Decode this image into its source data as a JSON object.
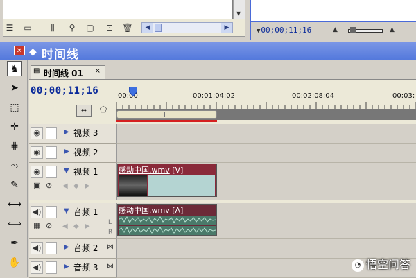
{
  "monitor": {
    "timecode": "00;00;11;16"
  },
  "timeline_panel": {
    "title": "时间线"
  },
  "sequence": {
    "tab_label": "时间线 01",
    "tab_close": "×",
    "timecode": "00;00;11;16",
    "ruler_labels": [
      "00;00",
      "00;01;04;02",
      "00;02;08;04",
      "00;03;"
    ]
  },
  "tracks": {
    "video3": {
      "name": "视频 3"
    },
    "video2": {
      "name": "视频 2"
    },
    "video1": {
      "name": "视频 1",
      "clip_label": "感动中国.wmv",
      "clip_tag": "[V]"
    },
    "audio1": {
      "name": "音频 1",
      "clip_label": "感动中国.wmv",
      "clip_tag": "[A]",
      "channel_l": "L",
      "channel_r": "R"
    },
    "audio2": {
      "name": "音频 2"
    },
    "audio3": {
      "name": "音频 3"
    }
  },
  "watermark": {
    "text": "悟空问答"
  },
  "colors": {
    "title_bar": "#5479dc",
    "timecode": "#0a2a9a",
    "playhead": "#e03030",
    "video_clip": "#8a2a3a",
    "audio_clip": "#4a7a6a"
  }
}
